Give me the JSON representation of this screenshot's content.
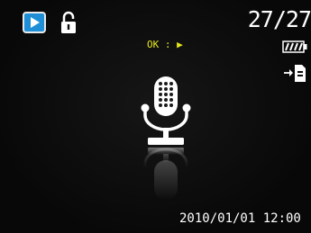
{
  "status_bar": {
    "mode_icon": "play-icon",
    "protect_icon": "lock-icon",
    "image_counter": "27/27",
    "ok_hint": "OK : ▶",
    "battery_icon": "battery-icon",
    "transfer_icon": "transfer-icon"
  },
  "content": {
    "file_icon": "microphone-icon"
  },
  "footer": {
    "date_time": "2010/01/01 12:00"
  },
  "colors": {
    "play_badge": "#1e8fd6",
    "hint_text": "#e7e81b",
    "foreground": "#ffffff",
    "background": "#0c0c0c"
  }
}
